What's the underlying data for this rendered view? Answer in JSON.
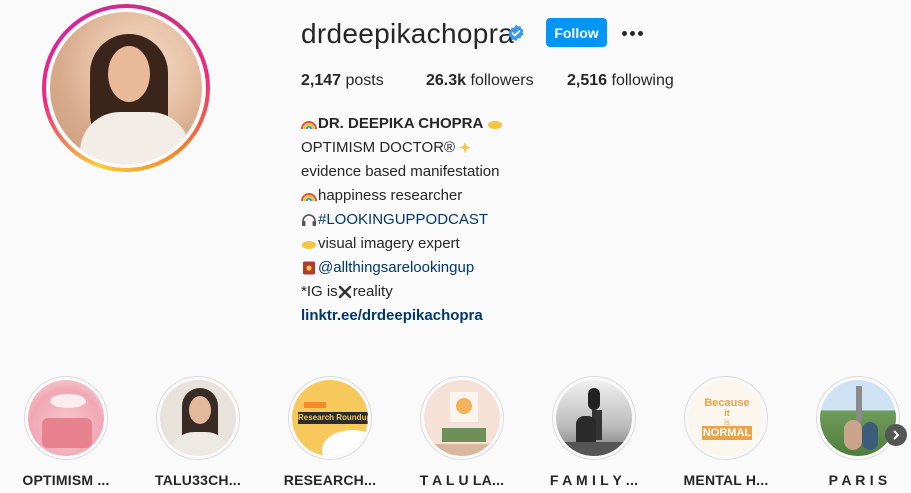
{
  "profile": {
    "username": "drdeepika­chopra",
    "follow_label": "Follow",
    "stats": {
      "posts_count": "2,147",
      "posts_label": "posts",
      "followers_count": "26.3k",
      "followers_label": "followers",
      "following_count": "2,516",
      "following_label": "following"
    },
    "bio": {
      "name": "DR. DEEPIKA CHOPRA",
      "lines": [
        "OPTIMISM DOCTOR®",
        "evidence based manifestation",
        "happiness researcher",
        "#LOOKINGUPPODCAST",
        "visual imagery expert",
        "@allthingsarelookingup",
        "*IG is",
        "reality"
      ],
      "website": "linktr.ee/drdeepikachopra"
    }
  },
  "highlights": [
    {
      "label": "OPTIMISM ...",
      "icon": "cake-cover"
    },
    {
      "label": "TALU33CH...",
      "icon": "portrait-cover"
    },
    {
      "label": "RESEARCH...",
      "icon": "research-roundup-cover",
      "cover_text": "Research Roundup"
    },
    {
      "label": "T A L U LA...",
      "icon": "product-cover"
    },
    {
      "label": "F A M I L Y ...",
      "icon": "family-cover"
    },
    {
      "label": "MENTAL H...",
      "icon": "mental-health-cover",
      "cover_text_1": "Because",
      "cover_text_2": "it",
      "cover_text_3": "is",
      "cover_text_4": "NORMAL"
    },
    {
      "label": "P A R I S",
      "icon": "paris-cover"
    }
  ],
  "colors": {
    "follow_button": "#0095f6",
    "link": "#00376b",
    "verified": "#3897f0"
  }
}
